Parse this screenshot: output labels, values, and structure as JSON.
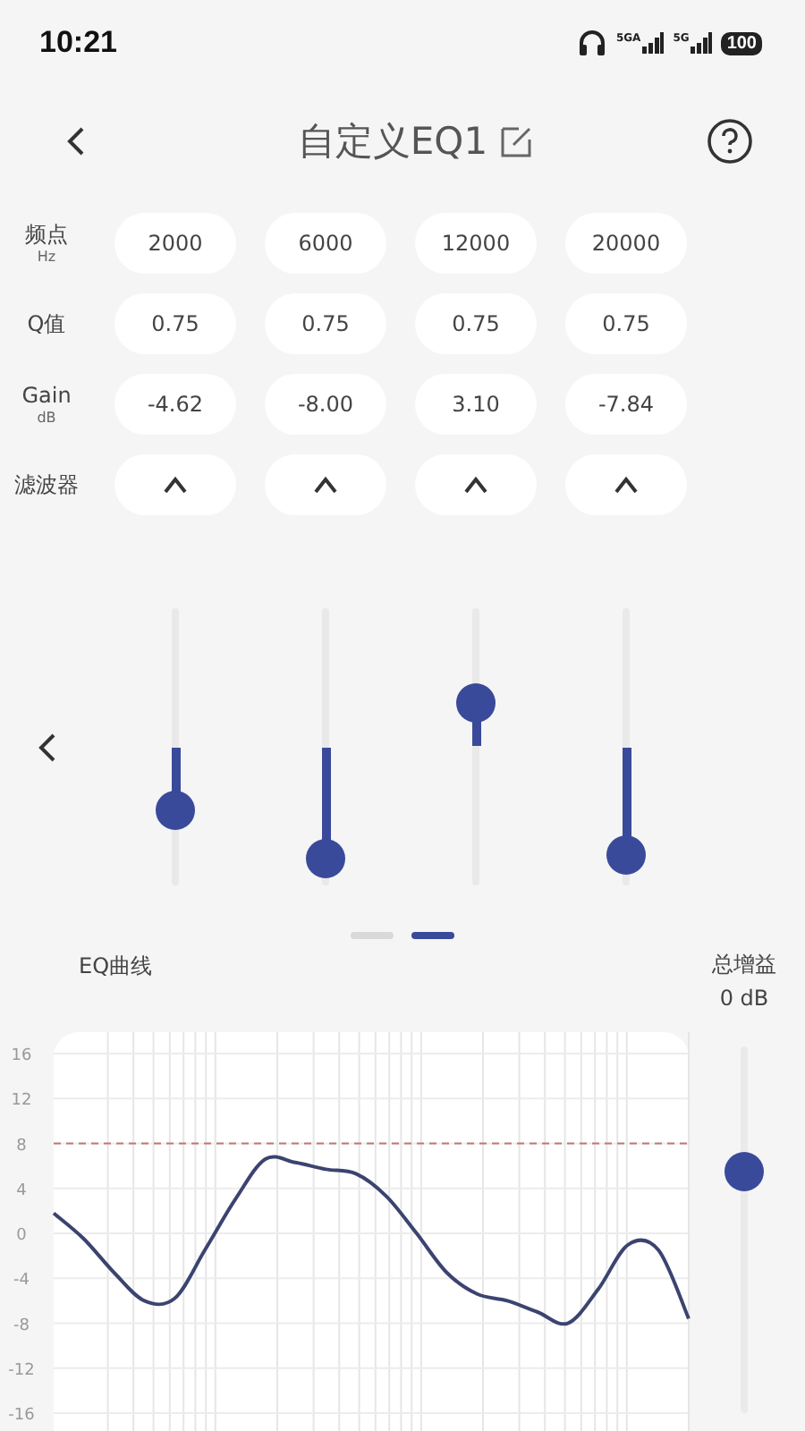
{
  "status_bar": {
    "time": "10:21",
    "network_1": "5GA",
    "network_2": "5G",
    "battery": "100"
  },
  "header": {
    "title": "自定义EQ1"
  },
  "params": [
    {
      "kind": "text",
      "label": "频点",
      "unit": "Hz",
      "values": [
        "2000",
        "6000",
        "12000",
        "20000"
      ]
    },
    {
      "kind": "text",
      "label": "Q值",
      "values": [
        "0.75",
        "0.75",
        "0.75",
        "0.75"
      ]
    },
    {
      "kind": "text",
      "label": "Gain",
      "unit": "dB",
      "values": [
        "-4.62",
        "-8.00",
        "3.10",
        "-7.84"
      ]
    },
    {
      "kind": "filter",
      "label": "滤波器",
      "filters": [
        {
          "kind": "peak"
        },
        {
          "kind": "peak"
        },
        {
          "kind": "peak"
        },
        {
          "kind": "peak"
        }
      ]
    }
  ],
  "pages": [
    {
      "selected": false
    },
    {
      "selected": true
    }
  ],
  "eq_curve": {
    "title": "EQ曲线",
    "chart_data": {
      "type": "line",
      "ylim": [
        -16,
        16
      ],
      "yticks": [
        16,
        12,
        8,
        4,
        0,
        -4,
        -8,
        -12,
        -16
      ],
      "series": [
        {
          "color": "#3b4470",
          "values": [
            1.8,
            -0.5,
            -3.5,
            -6,
            -5.8,
            -1.5,
            3,
            6.6,
            6.3,
            5.7,
            5.3,
            3.3,
            0,
            -3.5,
            -5.4,
            -6,
            -7,
            -8,
            -5,
            -1,
            -1.5,
            -7.6
          ]
        }
      ],
      "grid": true,
      "ref_lines": [
        {
          "axis": "y",
          "value": 8,
          "color": "#c0786e"
        }
      ]
    }
  },
  "total_gain": {
    "label": "总增益",
    "reading": "0 dB",
    "level": 0.66
  }
}
